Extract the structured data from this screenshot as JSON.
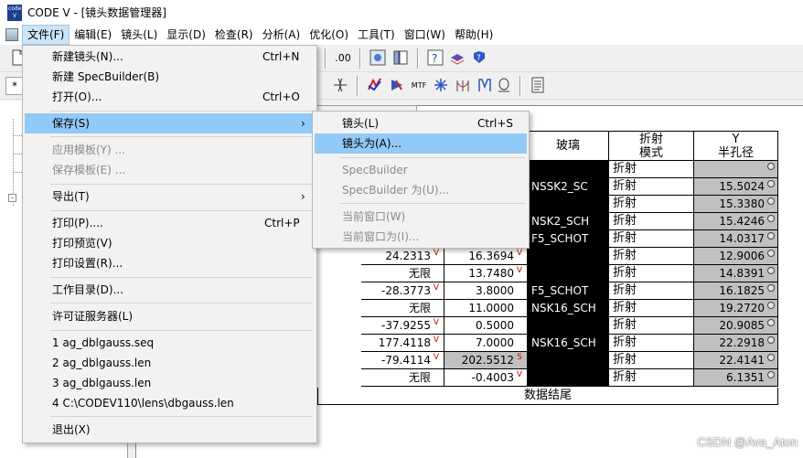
{
  "window": {
    "app_icon_text": "code V",
    "title": "CODE V - [镜头数据管理器]"
  },
  "menubar": [
    "文件(F)",
    "编辑(E)",
    "镜头(L)",
    "显示(D)",
    "检查(R)",
    "分析(A)",
    "优化(O)",
    "工具(T)",
    "窗口(W)",
    "帮助(H)"
  ],
  "toolbar": {
    "row1": [
      "new-file-icon",
      "zoom-00-icon",
      "image-plot-icon",
      "layout-icon",
      "help-cursor-icon",
      "layers-icon",
      "about-icon"
    ],
    "row2_field": "*",
    "row2": [
      "lens-element-icon",
      "optimize-icon",
      "paint-icon",
      "mtf-icon",
      "spot-icon",
      "field-curve-icon",
      "tolerance-icon",
      "report-icon"
    ],
    "row1_labels": {
      "zoom": ".00"
    },
    "row2_labels": {
      "mtf": "MTF"
    }
  },
  "file_menu": {
    "items": [
      {
        "label": "新建镜头(N)...",
        "shortcut": "Ctrl+N"
      },
      {
        "label": "新建 SpecBuilder(B)",
        "shortcut": ""
      },
      {
        "label": "打开(O)...",
        "shortcut": "Ctrl+O"
      },
      {
        "label": "保存(S)",
        "shortcut": "",
        "submenu": true
      },
      {
        "label": "应用模板(Y) ...",
        "shortcut": "",
        "disabled": true
      },
      {
        "label": "保存模板(E) ...",
        "shortcut": "",
        "disabled": true
      },
      {
        "label": "导出(T)",
        "shortcut": "",
        "submenu": true
      },
      {
        "label": "打印(P)....",
        "shortcut": "Ctrl+P"
      },
      {
        "label": "打印预览(V)",
        "shortcut": ""
      },
      {
        "label": "打印设置(R)...",
        "shortcut": ""
      },
      {
        "label": "工作目录(D)...",
        "shortcut": ""
      },
      {
        "label": "许可证服务器(L)",
        "shortcut": ""
      },
      {
        "label": "1 ag_dblgauss.seq",
        "shortcut": ""
      },
      {
        "label": "2 ag_dblgauss.len",
        "shortcut": ""
      },
      {
        "label": "3 ag_dblgauss.len",
        "shortcut": ""
      },
      {
        "label": "4 C:\\CODEV110\\lens\\dbgauss.len",
        "shortcut": ""
      },
      {
        "label": "退出(X)",
        "shortcut": ""
      }
    ],
    "submenu_arrow": "›"
  },
  "save_submenu": {
    "items": [
      {
        "label": "镜头(L)",
        "shortcut": "Ctrl+S"
      },
      {
        "label": "镜头为(A)...",
        "shortcut": ""
      },
      {
        "label": "SpecBuilder",
        "shortcut": "",
        "disabled": true
      },
      {
        "label": "SpecBuilder 为(U)...",
        "shortcut": "",
        "disabled": true
      },
      {
        "label": "当前窗口(W)",
        "shortcut": "",
        "disabled": true
      },
      {
        "label": "当前窗口为(I)...",
        "shortcut": "",
        "disabled": true
      }
    ]
  },
  "lens_table": {
    "headers": {
      "glass": "玻璃",
      "refract_1": "折射",
      "refract_2": "模式",
      "y_1": "Y",
      "y_2": "半孔径"
    },
    "rows": [
      {
        "radius": "",
        "r_flag": "",
        "thick": "",
        "t_flag": "",
        "glass": "",
        "mode": "折射",
        "semi": "",
        "glass_dark": true
      },
      {
        "radius": "",
        "r_flag": "",
        "thick": "",
        "t_flag": "",
        "glass": "NSSK2_SC",
        "mode": "折射",
        "semi": "15.5024",
        "glass_dark": true
      },
      {
        "radius": "",
        "r_flag": "",
        "thick": "",
        "t_flag": "",
        "glass": "",
        "mode": "折射",
        "semi": "15.3380",
        "glass_dark": true
      },
      {
        "radius": "",
        "r_flag": "",
        "thick": "",
        "t_flag": "",
        "glass": "NSK2_SCH",
        "mode": "折射",
        "semi": "15.4246",
        "glass_dark": true
      },
      {
        "radius": "",
        "r_flag": "",
        "thick": "",
        "t_flag": "",
        "glass": "F5_SCHOT",
        "mode": "折射",
        "semi": "14.0317",
        "glass_dark": true
      },
      {
        "radius": "24.2313",
        "r_flag": "V",
        "thick": "16.3694",
        "t_flag": "V",
        "glass": "",
        "mode": "折射",
        "semi": "12.9006",
        "glass_dark": true
      },
      {
        "radius": "无限",
        "r_flag": "",
        "thick": "13.7480",
        "t_flag": "V",
        "glass": "",
        "mode": "折射",
        "semi": "14.8391",
        "glass_dark": true
      },
      {
        "radius": "-28.3773",
        "r_flag": "V",
        "thick": "3.8000",
        "t_flag": "",
        "glass": "F5_SCHOT",
        "mode": "折射",
        "semi": "16.1825",
        "glass_dark": true
      },
      {
        "radius": "无限",
        "r_flag": "",
        "thick": "11.0000",
        "t_flag": "",
        "glass": "NSK16_SCH",
        "mode": "折射",
        "semi": "19.2720",
        "glass_dark": true
      },
      {
        "radius": "-37.9255",
        "r_flag": "V",
        "thick": "0.5000",
        "t_flag": "",
        "glass": "",
        "mode": "折射",
        "semi": "20.9085",
        "glass_dark": true
      },
      {
        "radius": "177.4118",
        "r_flag": "V",
        "thick": "7.0000",
        "t_flag": "",
        "glass": "NSK16_SCH",
        "mode": "折射",
        "semi": "22.2918",
        "glass_dark": true
      },
      {
        "radius": "-79.4114",
        "r_flag": "V",
        "thick": "202.5512",
        "t_flag": "S",
        "glass": "",
        "mode": "折射",
        "semi": "22.4141",
        "glass_dark": true
      },
      {
        "radius": "无限",
        "r_flag": "",
        "thick": "-0.4003",
        "t_flag": "V",
        "glass": "",
        "mode": "折射",
        "semi": "6.1351",
        "glass_dark": true
      }
    ],
    "end_label": "数据结尾"
  },
  "watermark": "CSDN @Ava_Aton"
}
